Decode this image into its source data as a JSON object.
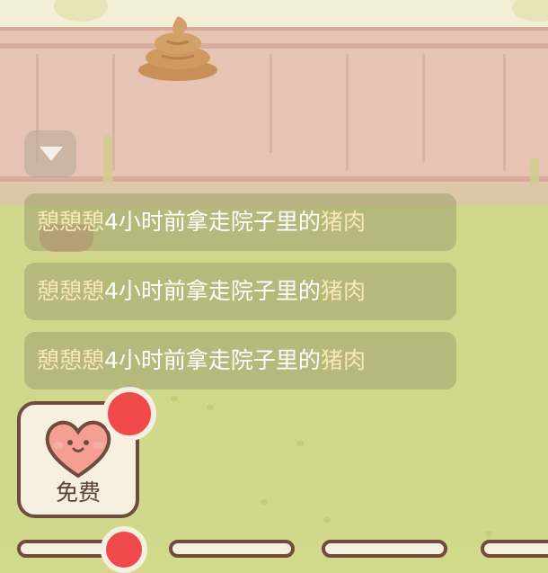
{
  "notifications": [
    {
      "actor": "憩憩憩",
      "text": "4小时前拿走院子里的",
      "item": "猪肉"
    },
    {
      "actor": "憩憩憩",
      "text": "4小时前拿走院子里的",
      "item": "猪肉"
    },
    {
      "actor": "憩憩憩",
      "text": "4小时前拿走院子里的",
      "item": "猪肉"
    }
  ],
  "gift_button": {
    "label": "免费",
    "icon": "heart-face-icon",
    "has_badge": true
  },
  "colors": {
    "badge": "#f0494c",
    "highlight_text": "#f6e9b6",
    "frame": "#6f4c3e"
  },
  "icons": {
    "side_button": "triangle-down-icon",
    "yard_object": "poop-icon"
  }
}
